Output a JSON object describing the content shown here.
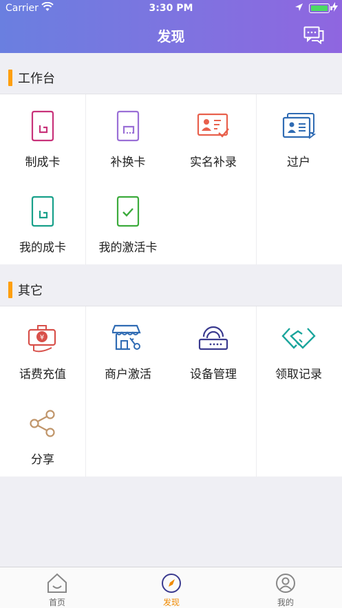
{
  "status_bar": {
    "carrier": "Carrier",
    "time": "3:30 PM"
  },
  "nav": {
    "title": "发现",
    "message_icon": "chat-bubbles-icon"
  },
  "sections": [
    {
      "title": "工作台",
      "items": [
        {
          "label": "制成卡",
          "icon": "sim-card-icon",
          "color": "#c8327a"
        },
        {
          "label": "补换卡",
          "icon": "sim-card-replace-icon",
          "color": "#9a6fd6"
        },
        {
          "label": "实名补录",
          "icon": "id-card-check-icon",
          "color": "#e8604c"
        },
        {
          "label": "过户",
          "icon": "id-card-transfer-icon",
          "color": "#2f6bb3"
        },
        {
          "label": "我的成卡",
          "icon": "sim-card-list-icon",
          "color": "#18a08a"
        },
        {
          "label": "我的激活卡",
          "icon": "sim-card-check-icon",
          "color": "#3cab3c"
        }
      ]
    },
    {
      "title": "其它",
      "items": [
        {
          "label": "话费充值",
          "icon": "recharge-icon",
          "color": "#d8504a"
        },
        {
          "label": "商户激活",
          "icon": "shop-key-icon",
          "color": "#2f6bb3"
        },
        {
          "label": "设备管理",
          "icon": "router-icon",
          "color": "#3a3a8f"
        },
        {
          "label": "领取记录",
          "icon": "handshake-icon",
          "color": "#1aa59c"
        },
        {
          "label": "分享",
          "icon": "share-icon",
          "color": "#c0956a"
        }
      ]
    }
  ],
  "tabbar": [
    {
      "label": "首页",
      "icon": "home-icon",
      "active": false
    },
    {
      "label": "发现",
      "icon": "discover-compass-icon",
      "active": true
    },
    {
      "label": "我的",
      "icon": "profile-icon",
      "active": false
    }
  ]
}
